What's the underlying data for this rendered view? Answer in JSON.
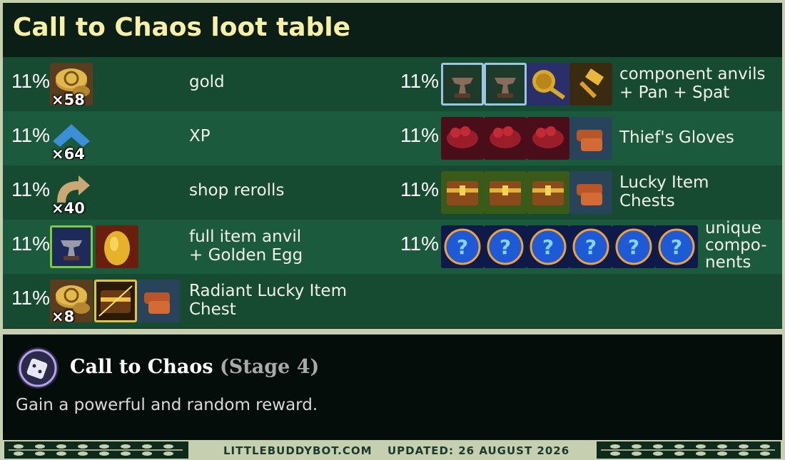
{
  "title": "Call to Chaos loot table",
  "left_rows": [
    {
      "pct": "11%",
      "label_lines": [
        "gold"
      ],
      "icons": [
        "gold-coins-icon"
      ],
      "count": "×58"
    },
    {
      "pct": "11%",
      "label_lines": [
        "XP"
      ],
      "icons": [
        "xp-chevron-icon"
      ],
      "count": "×64"
    },
    {
      "pct": "11%",
      "label_lines": [
        "shop rerolls"
      ],
      "icons": [
        "reroll-arrow-icon"
      ],
      "count": "×40"
    },
    {
      "pct": "11%",
      "label_lines": [
        "full item anvil",
        "+ Golden Egg"
      ],
      "icons": [
        "full-item-anvil-icon",
        "golden-egg-icon"
      ]
    },
    {
      "pct": "11%",
      "label_lines": [
        "Radiant Lucky Item",
        "Chest"
      ],
      "icons": [
        "gold-coins-icon",
        "radiant-chest-icon",
        "component-icon"
      ],
      "count": "×8"
    }
  ],
  "right_rows": [
    {
      "pct": "11%",
      "label_lines": [
        "component anvils",
        "+ Pan + Spat"
      ],
      "icons": [
        "component-anvil-icon",
        "component-anvil-icon",
        "frying-pan-icon",
        "spatula-icon"
      ]
    },
    {
      "pct": "11%",
      "label_lines": [
        "Thief's Gloves"
      ],
      "icons": [
        "sparring-gloves-icon",
        "sparring-gloves-icon",
        "sparring-gloves-icon",
        "thiefs-gloves-icon"
      ]
    },
    {
      "pct": "11%",
      "label_lines": [
        "Lucky Item",
        "Chests"
      ],
      "icons": [
        "lucky-chest-icon",
        "lucky-chest-icon",
        "lucky-chest-icon",
        "item-component-icon"
      ]
    },
    {
      "pct": "11%",
      "label_lines": [
        "unique",
        "compo-",
        "nents"
      ],
      "icons": [
        "mystery-orb-icon",
        "mystery-orb-icon",
        "mystery-orb-icon",
        "mystery-orb-icon",
        "mystery-orb-icon",
        "mystery-orb-icon"
      ]
    }
  ],
  "augment": {
    "name": "Call to Chaos",
    "stage": "(Stage 4)",
    "description": "Gain a powerful and random reward.",
    "icon": "chaos-dice-icon"
  },
  "footer": {
    "site": "LITTLEBUDDYBOT.COM",
    "updated": "UPDATED: 26 AUGUST 2026"
  },
  "colors": {
    "title": "#f7f0a6",
    "row_light": "#1b5a3c",
    "row_dark": "#164a31",
    "border": "#c6cfb0"
  }
}
